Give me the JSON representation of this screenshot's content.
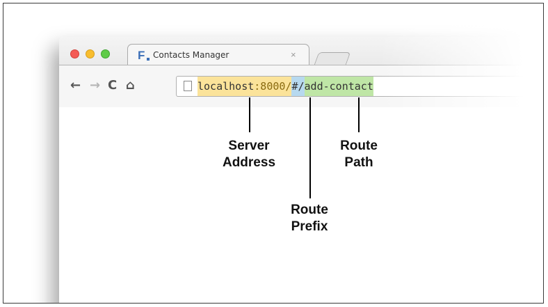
{
  "browser": {
    "tab": {
      "logo": "F",
      "title": "Contacts Manager",
      "close": "×"
    },
    "nav": {
      "back": "←",
      "forward": "→",
      "reload": "C",
      "home": "⌂"
    },
    "url": {
      "server_host": "localhost",
      "server_port": ":8000/",
      "route_prefix": "#/",
      "route_path": "add-contact"
    }
  },
  "annotations": {
    "server_address": [
      "Server",
      "Address"
    ],
    "route_path": [
      "Route",
      "Path"
    ],
    "route_prefix": [
      "Route",
      "Prefix"
    ]
  },
  "colors": {
    "server_highlight": "#fbe39a",
    "prefix_highlight": "#b7d9ef",
    "path_highlight": "#bfe6a6"
  }
}
